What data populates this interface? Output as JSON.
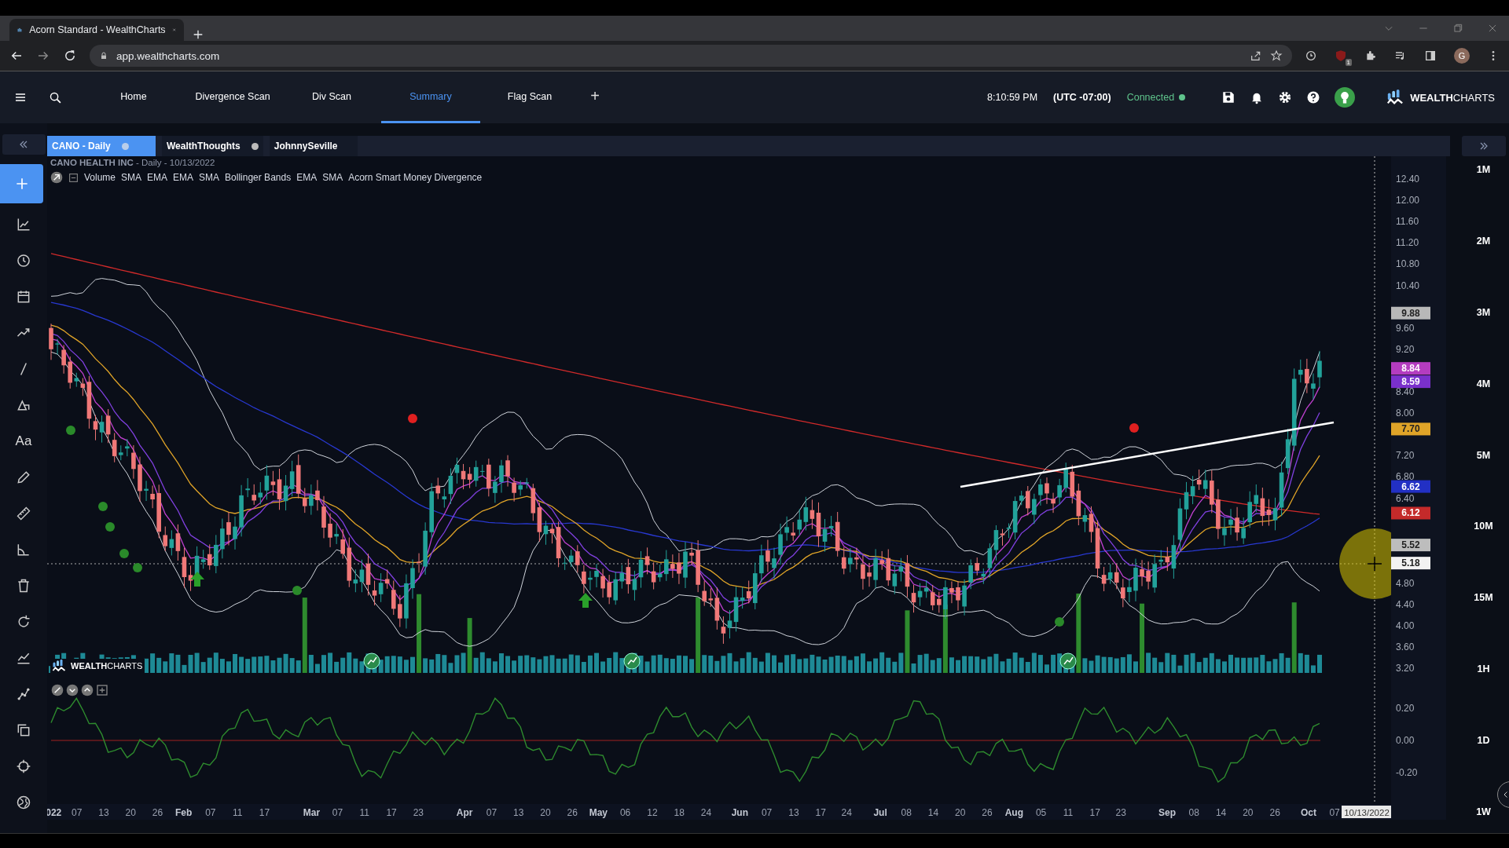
{
  "browser": {
    "tab_title": "Acorn Standard - WealthCharts",
    "url": "app.wealthcharts.com",
    "extension_badge": "1",
    "profile_initial": "G"
  },
  "header": {
    "nav": [
      {
        "label": "Home",
        "selected": false
      },
      {
        "label": "Divergence Scan",
        "selected": false
      },
      {
        "label": "Div Scan",
        "selected": false
      },
      {
        "label": "Summary",
        "selected": true
      },
      {
        "label": "Flag Scan",
        "selected": false
      }
    ],
    "add_tab": "+",
    "time": "8:10:59 PM",
    "timezone": "(UTC -07:00)",
    "status": "Connected",
    "brand": "**WEALTH**CHARTS"
  },
  "toolbar": {
    "text_tool": "Aa"
  },
  "chart_tabs": [
    {
      "label": "CANO - Daily",
      "selected": true
    },
    {
      "label": "WealthThoughts",
      "selected": false
    },
    {
      "label": "JohnnySeville",
      "selected": false
    }
  ],
  "chart": {
    "company": "CANO HEALTH INC",
    "details": " - Daily - 10/13/2022",
    "indicators": [
      "Volume",
      "SMA",
      "EMA",
      "EMA",
      "SMA",
      "Bollinger Bands",
      "EMA",
      "SMA",
      "Acorn Smart Money Divergence"
    ],
    "price_ticks": [
      "12.40",
      "12.00",
      "11.60",
      "11.20",
      "10.80",
      "10.40",
      "9.60",
      "9.20",
      "8.40",
      "8.00",
      "7.20",
      "6.80",
      "6.40",
      "4.80",
      "4.40",
      "4.00",
      "3.60",
      "3.20"
    ],
    "price_tags": [
      {
        "value": "9.88",
        "color": "#b8b8b8"
      },
      {
        "value": "8.84",
        "color": "#b43cc0"
      },
      {
        "value": "8.59",
        "color": "#7a30cc"
      },
      {
        "value": "7.70",
        "color": "#e0a428"
      },
      {
        "value": "6.62",
        "color": "#2230c4"
      },
      {
        "value": "6.12",
        "color": "#c42a2a"
      },
      {
        "value": "5.52",
        "color": "#bdbdbd"
      },
      {
        "value": "5.18",
        "color": "#f2f2f2"
      }
    ],
    "oscillator_ticks": [
      "0.20",
      "0.00",
      "-0.20"
    ],
    "date_labels": [
      {
        "label": "022",
        "major": true
      },
      {
        "label": "07",
        "major": false
      },
      {
        "label": "13",
        "major": false
      },
      {
        "label": "20",
        "major": false
      },
      {
        "label": "26",
        "major": false
      },
      {
        "label": "Feb",
        "major": true
      },
      {
        "label": "07",
        "major": false
      },
      {
        "label": "11",
        "major": false
      },
      {
        "label": "17",
        "major": false
      },
      {
        "label": "Mar",
        "major": true
      },
      {
        "label": "07",
        "major": false
      },
      {
        "label": "11",
        "major": false
      },
      {
        "label": "17",
        "major": false
      },
      {
        "label": "23",
        "major": false
      },
      {
        "label": "Apr",
        "major": true
      },
      {
        "label": "07",
        "major": false
      },
      {
        "label": "13",
        "major": false
      },
      {
        "label": "20",
        "major": false
      },
      {
        "label": "26",
        "major": false
      },
      {
        "label": "May",
        "major": true
      },
      {
        "label": "06",
        "major": false
      },
      {
        "label": "12",
        "major": false
      },
      {
        "label": "18",
        "major": false
      },
      {
        "label": "24",
        "major": false
      },
      {
        "label": "Jun",
        "major": true
      },
      {
        "label": "07",
        "major": false
      },
      {
        "label": "13",
        "major": false
      },
      {
        "label": "17",
        "major": false
      },
      {
        "label": "24",
        "major": false
      },
      {
        "label": "Jul",
        "major": true
      },
      {
        "label": "08",
        "major": false
      },
      {
        "label": "14",
        "major": false
      },
      {
        "label": "20",
        "major": false
      },
      {
        "label": "26",
        "major": false
      },
      {
        "label": "Aug",
        "major": true
      },
      {
        "label": "05",
        "major": false
      },
      {
        "label": "11",
        "major": false
      },
      {
        "label": "17",
        "major": false
      },
      {
        "label": "23",
        "major": false
      },
      {
        "label": "Sep",
        "major": true
      },
      {
        "label": "08",
        "major": false
      },
      {
        "label": "14",
        "major": false
      },
      {
        "label": "20",
        "major": false
      },
      {
        "label": "26",
        "major": false
      },
      {
        "label": "Oct",
        "major": true
      },
      {
        "label": "07",
        "major": false
      }
    ],
    "crosshair_date": "10/13/2022",
    "watermark": "**WEALTH**CHARTS"
  },
  "timeframes": [
    "1M",
    "2M",
    "3M",
    "4M",
    "5M",
    "10M",
    "15M",
    "1H",
    "1D",
    "1W"
  ]
}
